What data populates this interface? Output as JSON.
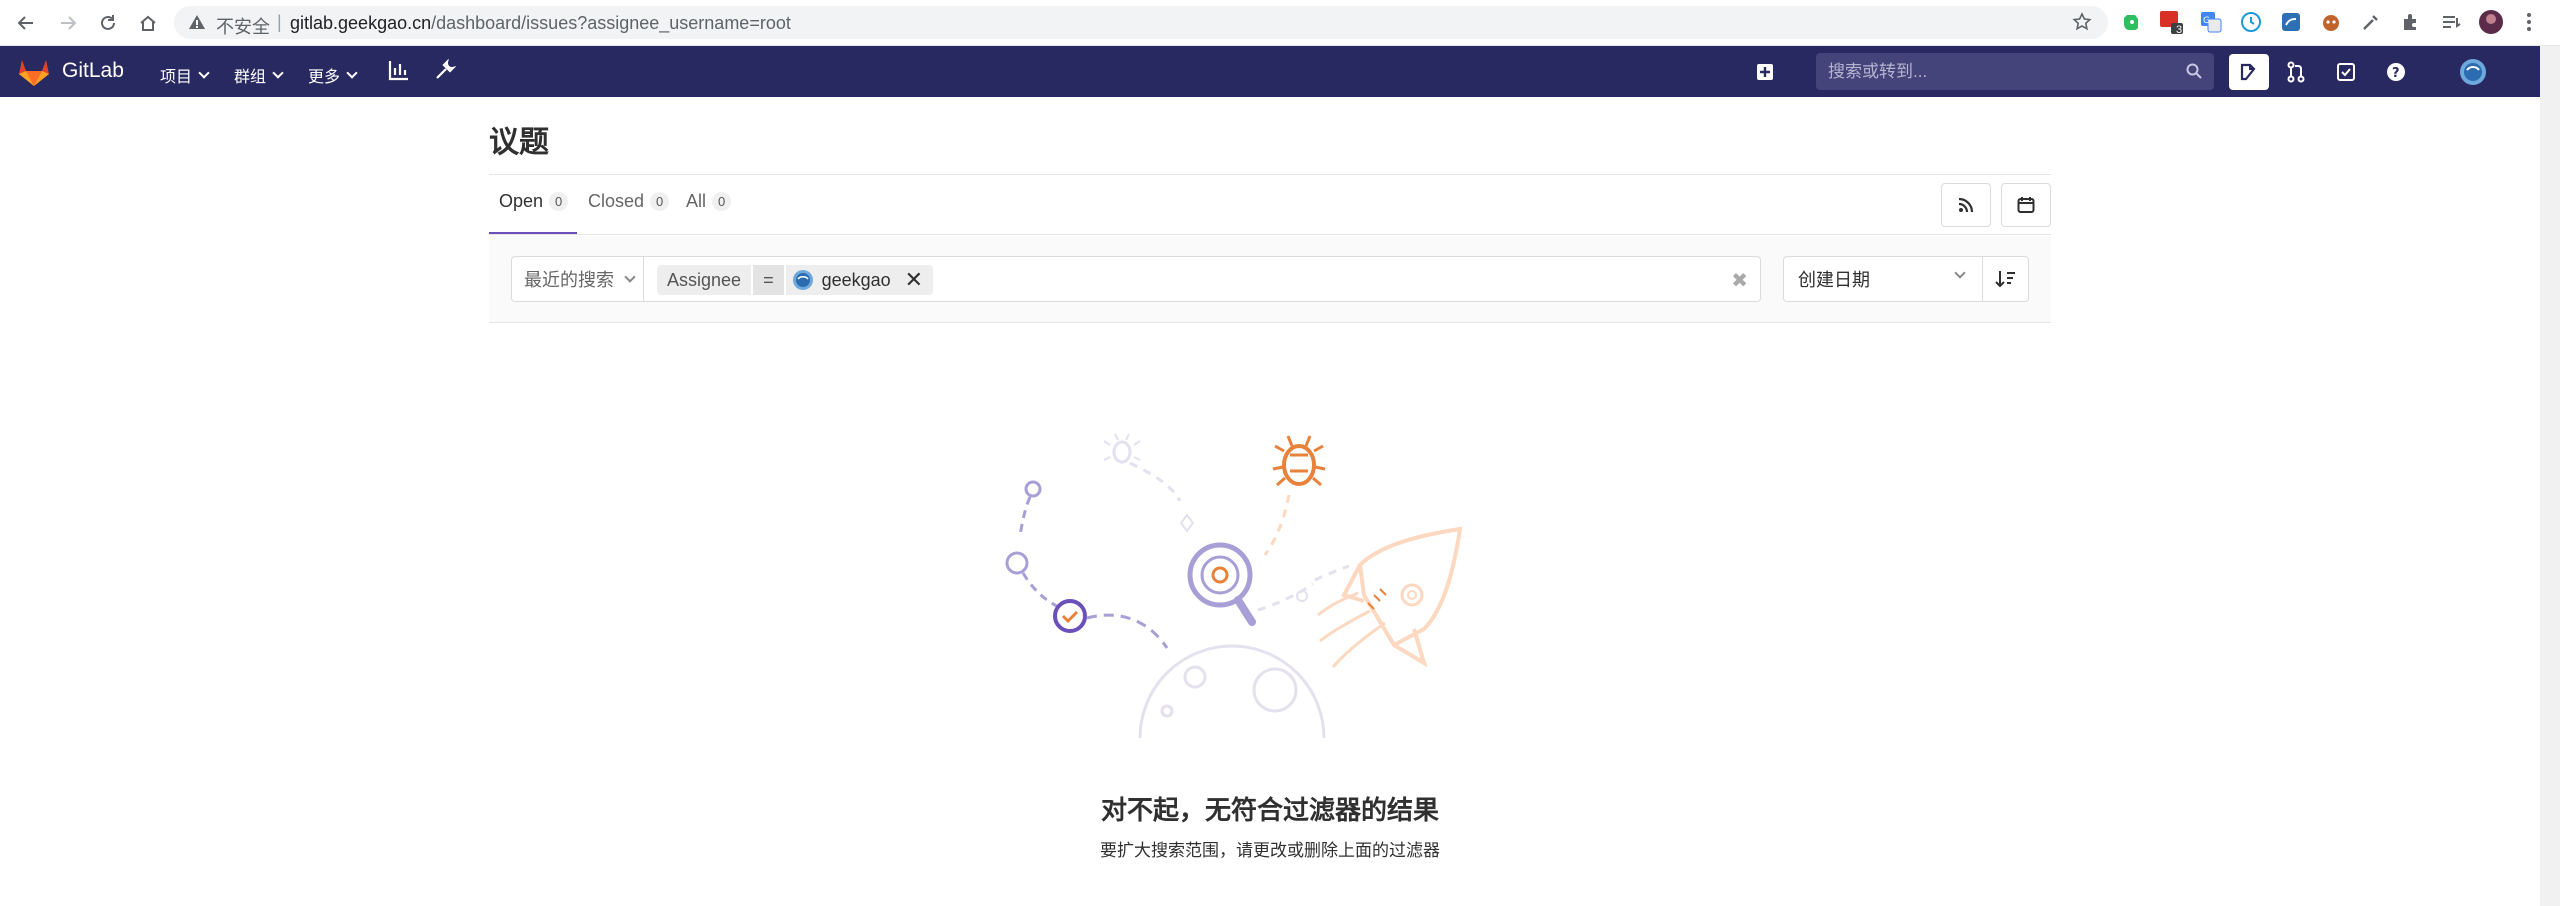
{
  "browser": {
    "insecure_label": "不安全",
    "url_host": "gitlab.geekgao.cn",
    "url_path": "/dashboard/issues?assignee_username=root",
    "ext_badge": "3"
  },
  "navbar": {
    "brand": "GitLab",
    "menus": [
      {
        "label": "项目"
      },
      {
        "label": "群组"
      },
      {
        "label": "更多"
      }
    ],
    "search_placeholder": "搜索或转到..."
  },
  "page": {
    "title": "议题",
    "tabs": [
      {
        "label": "Open",
        "count": "0"
      },
      {
        "label": "Closed",
        "count": "0"
      },
      {
        "label": "All",
        "count": "0"
      }
    ]
  },
  "filter": {
    "recent_label": "最近的搜索",
    "token_name": "Assignee",
    "token_operator": "=",
    "token_value": "geekgao",
    "sort_label": "创建日期"
  },
  "empty_state": {
    "title": "对不起，无符合过滤器的结果",
    "subtitle": "要扩大搜索范围，请更改或删除上面的过滤器"
  },
  "colors": {
    "navbar": "#292961",
    "accent": "#6b4fbb",
    "orange": "#e8813a"
  }
}
